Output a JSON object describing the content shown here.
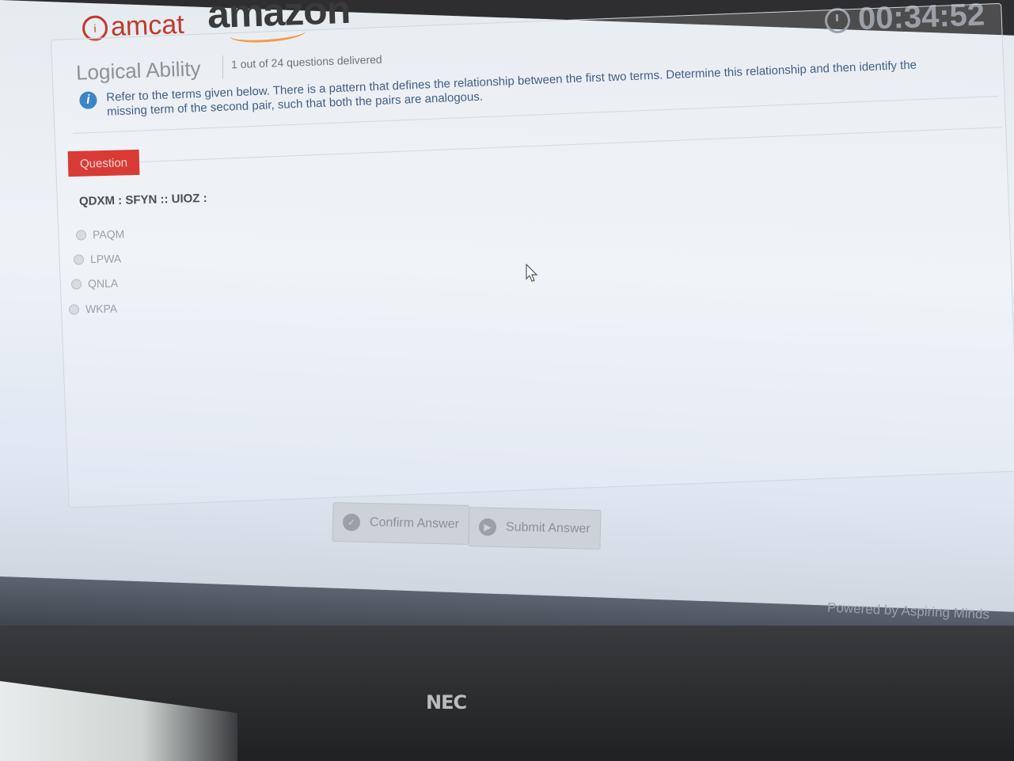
{
  "header": {
    "logo_text": "amcat",
    "partner_logo": "amazon",
    "timer": "00:34:52"
  },
  "section": {
    "title": "Logical Ability",
    "progress": "1 out of 24 questions delivered"
  },
  "instructions": "Refer to the terms given below. There is a pattern that defines the relationship between the first two terms. Determine this relationship and then identify the missing term of the second pair, such that both the pairs are analogous.",
  "question": {
    "tab_label": "Question",
    "text": "QDXM : SFYN :: UIOZ :",
    "options": [
      "PAQM",
      "LPWA",
      "QNLA",
      "WKPA"
    ]
  },
  "buttons": {
    "confirm": "Confirm Answer",
    "submit": "Submit Answer"
  },
  "footer": {
    "powered_by": "Powered by Aspiring Minds"
  },
  "monitor": {
    "brand": "NEC"
  },
  "colors": {
    "accent_red": "#d93a35",
    "info_blue": "#3b86c8"
  }
}
